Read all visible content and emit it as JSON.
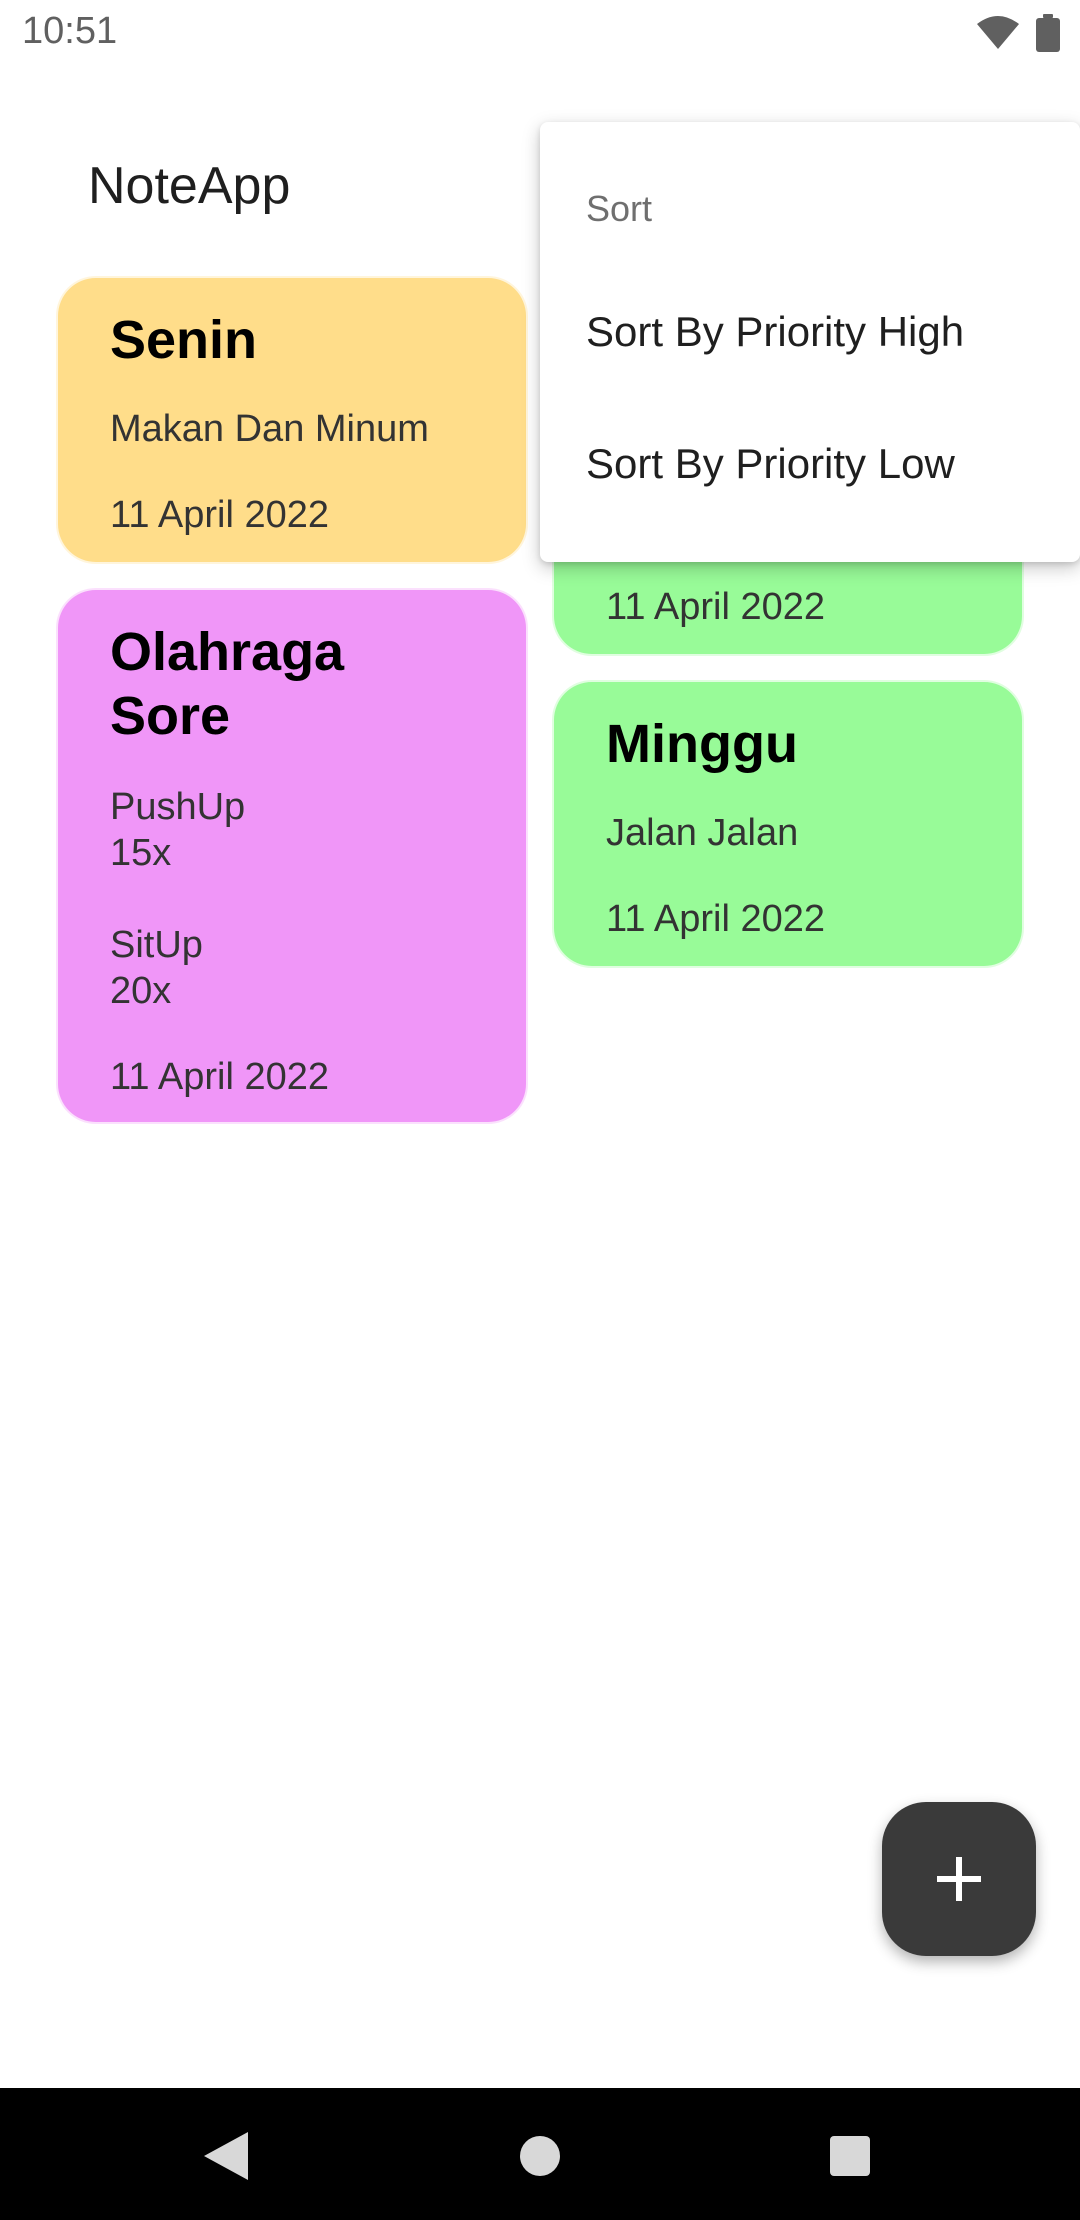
{
  "status_bar": {
    "time": "10:51",
    "icons": [
      "wifi-icon",
      "battery-icon"
    ]
  },
  "app": {
    "title": "NoteApp"
  },
  "notes": [
    {
      "title": "Senin",
      "body": "Makan Dan Minum",
      "date": "11 April 2022",
      "color": "#FFDD8A"
    },
    {
      "title": "Olahraga\nSore",
      "body": "PushUp\n15x\n\nSitUp\n20x",
      "date": "11 April 2022",
      "color": "#F096F8"
    },
    {
      "title": "",
      "body": "",
      "date": "11 April 2022",
      "color": "#98FB98"
    },
    {
      "title": "Minggu",
      "body": "Jalan Jalan",
      "date": "11 April 2022",
      "color": "#98FB98"
    }
  ],
  "sort_menu": {
    "header": "Sort",
    "items": [
      {
        "label": "Sort By Priority High"
      },
      {
        "label": "Sort By Priority Low"
      }
    ]
  },
  "fab": {
    "icon": "plus-icon",
    "color": "#3A3A3A"
  },
  "nav_bar": {
    "icons": [
      "back-icon",
      "home-icon",
      "recents-icon"
    ]
  }
}
